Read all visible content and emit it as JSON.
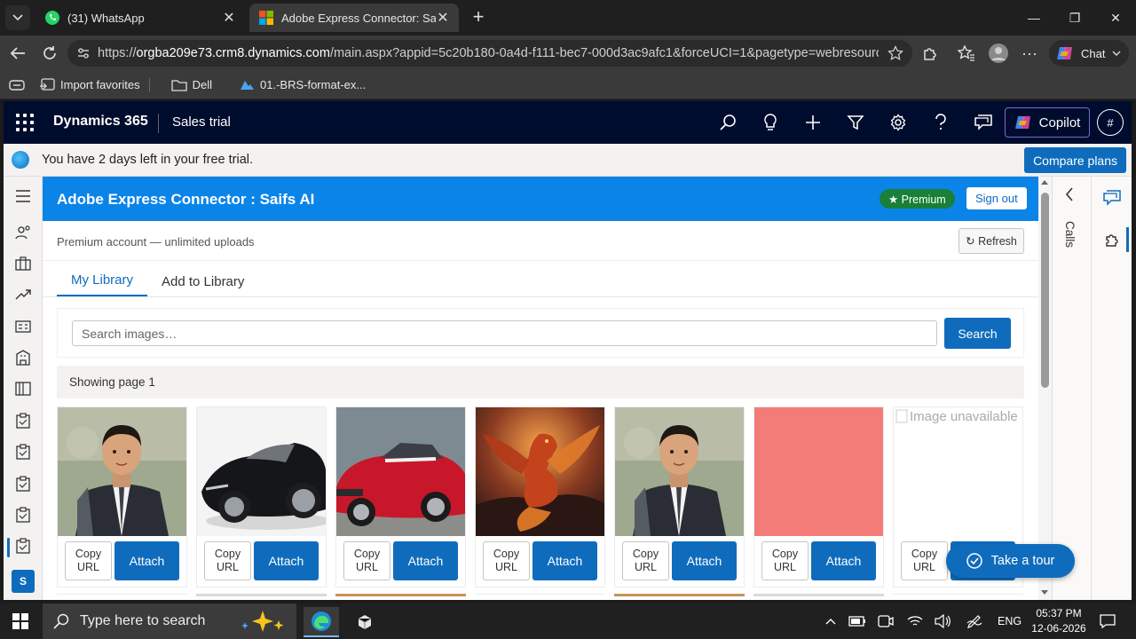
{
  "browser": {
    "tabs": [
      {
        "title": "(31) WhatsApp",
        "icon": "whatsapp-icon",
        "active": false
      },
      {
        "title": "Adobe Express Connector: Saifs AI",
        "icon": "microsoft-icon",
        "active": true
      }
    ],
    "url_prefix": "https://",
    "url_host": "orgba209e73.crm8.dynamics.com",
    "url_path": "/main.aspx?appid=5c20b180-0a4d-f111-bec7-000d3ac9afc1&forceUCI=1&pagetype=webresource...",
    "chat_label": "Chat",
    "favorites": [
      {
        "label": "Import favorites",
        "icon": "import-icon"
      },
      {
        "label": "Dell",
        "icon": "folder-icon"
      },
      {
        "label": "01.-BRS-format-ex...",
        "icon": "onedrive-icon"
      }
    ]
  },
  "d365": {
    "brand": "Dynamics 365",
    "app_name": "Sales trial",
    "copilot_label": "Copilot",
    "avatar_label": "#",
    "trial_message": "You have 2 days left in your free trial.",
    "compare_label": "Compare plans",
    "user_initial": "S"
  },
  "panel": {
    "title": "Adobe Express Connector : Saifs AI",
    "premium_badge": "★ Premium",
    "signout_label": "Sign out",
    "account_text": "Premium account — unlimited uploads",
    "refresh_label": "↻ Refresh",
    "tabs": [
      {
        "label": "My Library",
        "active": true
      },
      {
        "label": "Add to Library",
        "active": false
      }
    ],
    "search_placeholder": "Search images…",
    "search_button": "Search",
    "page_info": "Showing page 1",
    "copy_label_line1": "Copy",
    "copy_label_line2": "URL",
    "attach_label": "Attach",
    "images": [
      {
        "kind": "boy"
      },
      {
        "kind": "black-car"
      },
      {
        "kind": "red-car"
      },
      {
        "kind": "dragon"
      },
      {
        "kind": "boy"
      },
      {
        "kind": "salmon",
        "color": "#f47c78"
      },
      {
        "kind": "unavailable",
        "alt": "Image unavailable"
      }
    ],
    "tour_label": "Take a tour"
  },
  "right": {
    "calls_label": "Calls"
  },
  "taskbar": {
    "search_placeholder": "Type here to search",
    "language": "ENG",
    "time": "05:37 PM",
    "date": "12-06-2026"
  }
}
